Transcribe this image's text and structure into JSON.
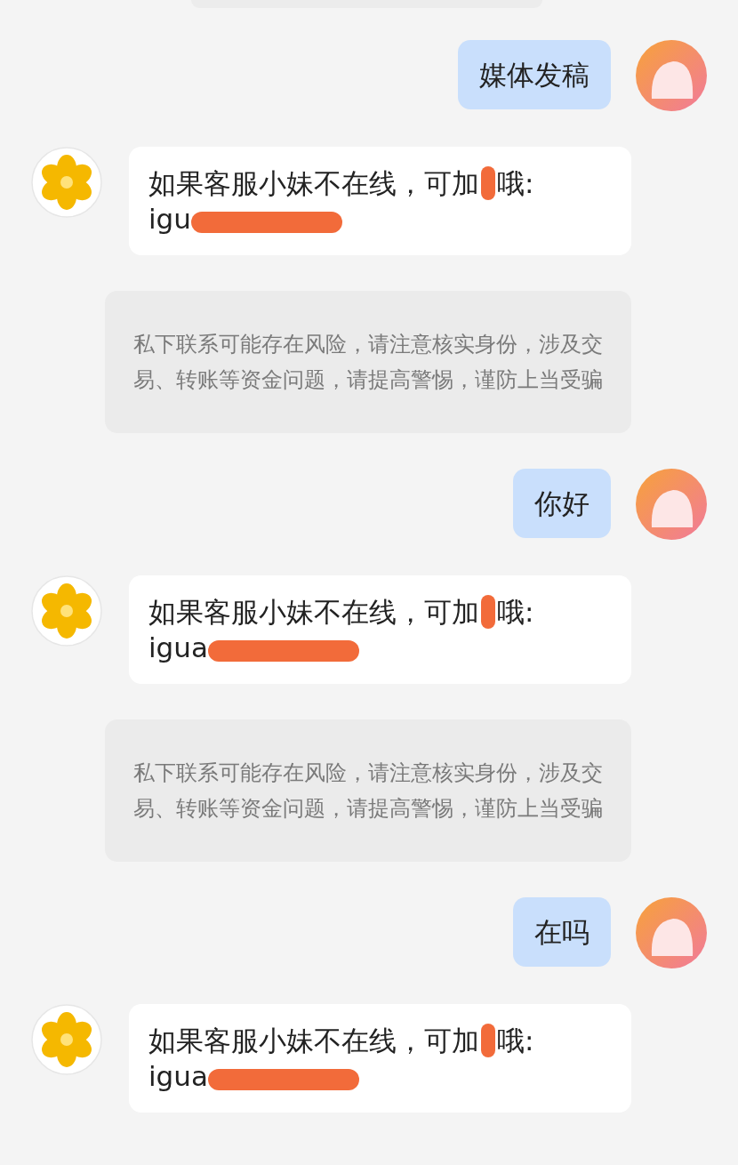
{
  "messages": [
    {
      "kind": "user",
      "text": "媒体发稿"
    },
    {
      "kind": "bot",
      "lines": [
        [
          {
            "kind": "text",
            "text": "如果客服小妹不在线，可加"
          },
          {
            "kind": "redaction-blob"
          },
          {
            "kind": "text",
            "text": "哦:"
          }
        ],
        [
          {
            "kind": "text",
            "text": "igu"
          },
          {
            "kind": "redaction-stroke"
          }
        ]
      ]
    },
    {
      "kind": "notice",
      "text": "私下联系可能存在风险，请注意核实身份，涉及交易、转账等资金问题，请提高警惕，谨防上当受骗"
    },
    {
      "kind": "user",
      "text": "你好"
    },
    {
      "kind": "bot",
      "lines": [
        [
          {
            "kind": "text",
            "text": "如果客服小妹不在线，可加"
          },
          {
            "kind": "redaction-blob"
          },
          {
            "kind": "text",
            "text": "哦:"
          }
        ],
        [
          {
            "kind": "text",
            "text": "igua"
          },
          {
            "kind": "redaction-stroke"
          }
        ]
      ]
    },
    {
      "kind": "notice",
      "text": "私下联系可能存在风险，请注意核实身份，涉及交易、转账等资金问题，请提高警惕，谨防上当受骗"
    },
    {
      "kind": "user",
      "text": "在吗"
    },
    {
      "kind": "bot",
      "lines": [
        [
          {
            "kind": "text",
            "text": "如果客服小妹不在线，可加"
          },
          {
            "kind": "redaction-blob"
          },
          {
            "kind": "text",
            "text": "哦:"
          }
        ],
        [
          {
            "kind": "text",
            "text": "igua"
          },
          {
            "kind": "redaction-stroke"
          }
        ]
      ]
    }
  ]
}
